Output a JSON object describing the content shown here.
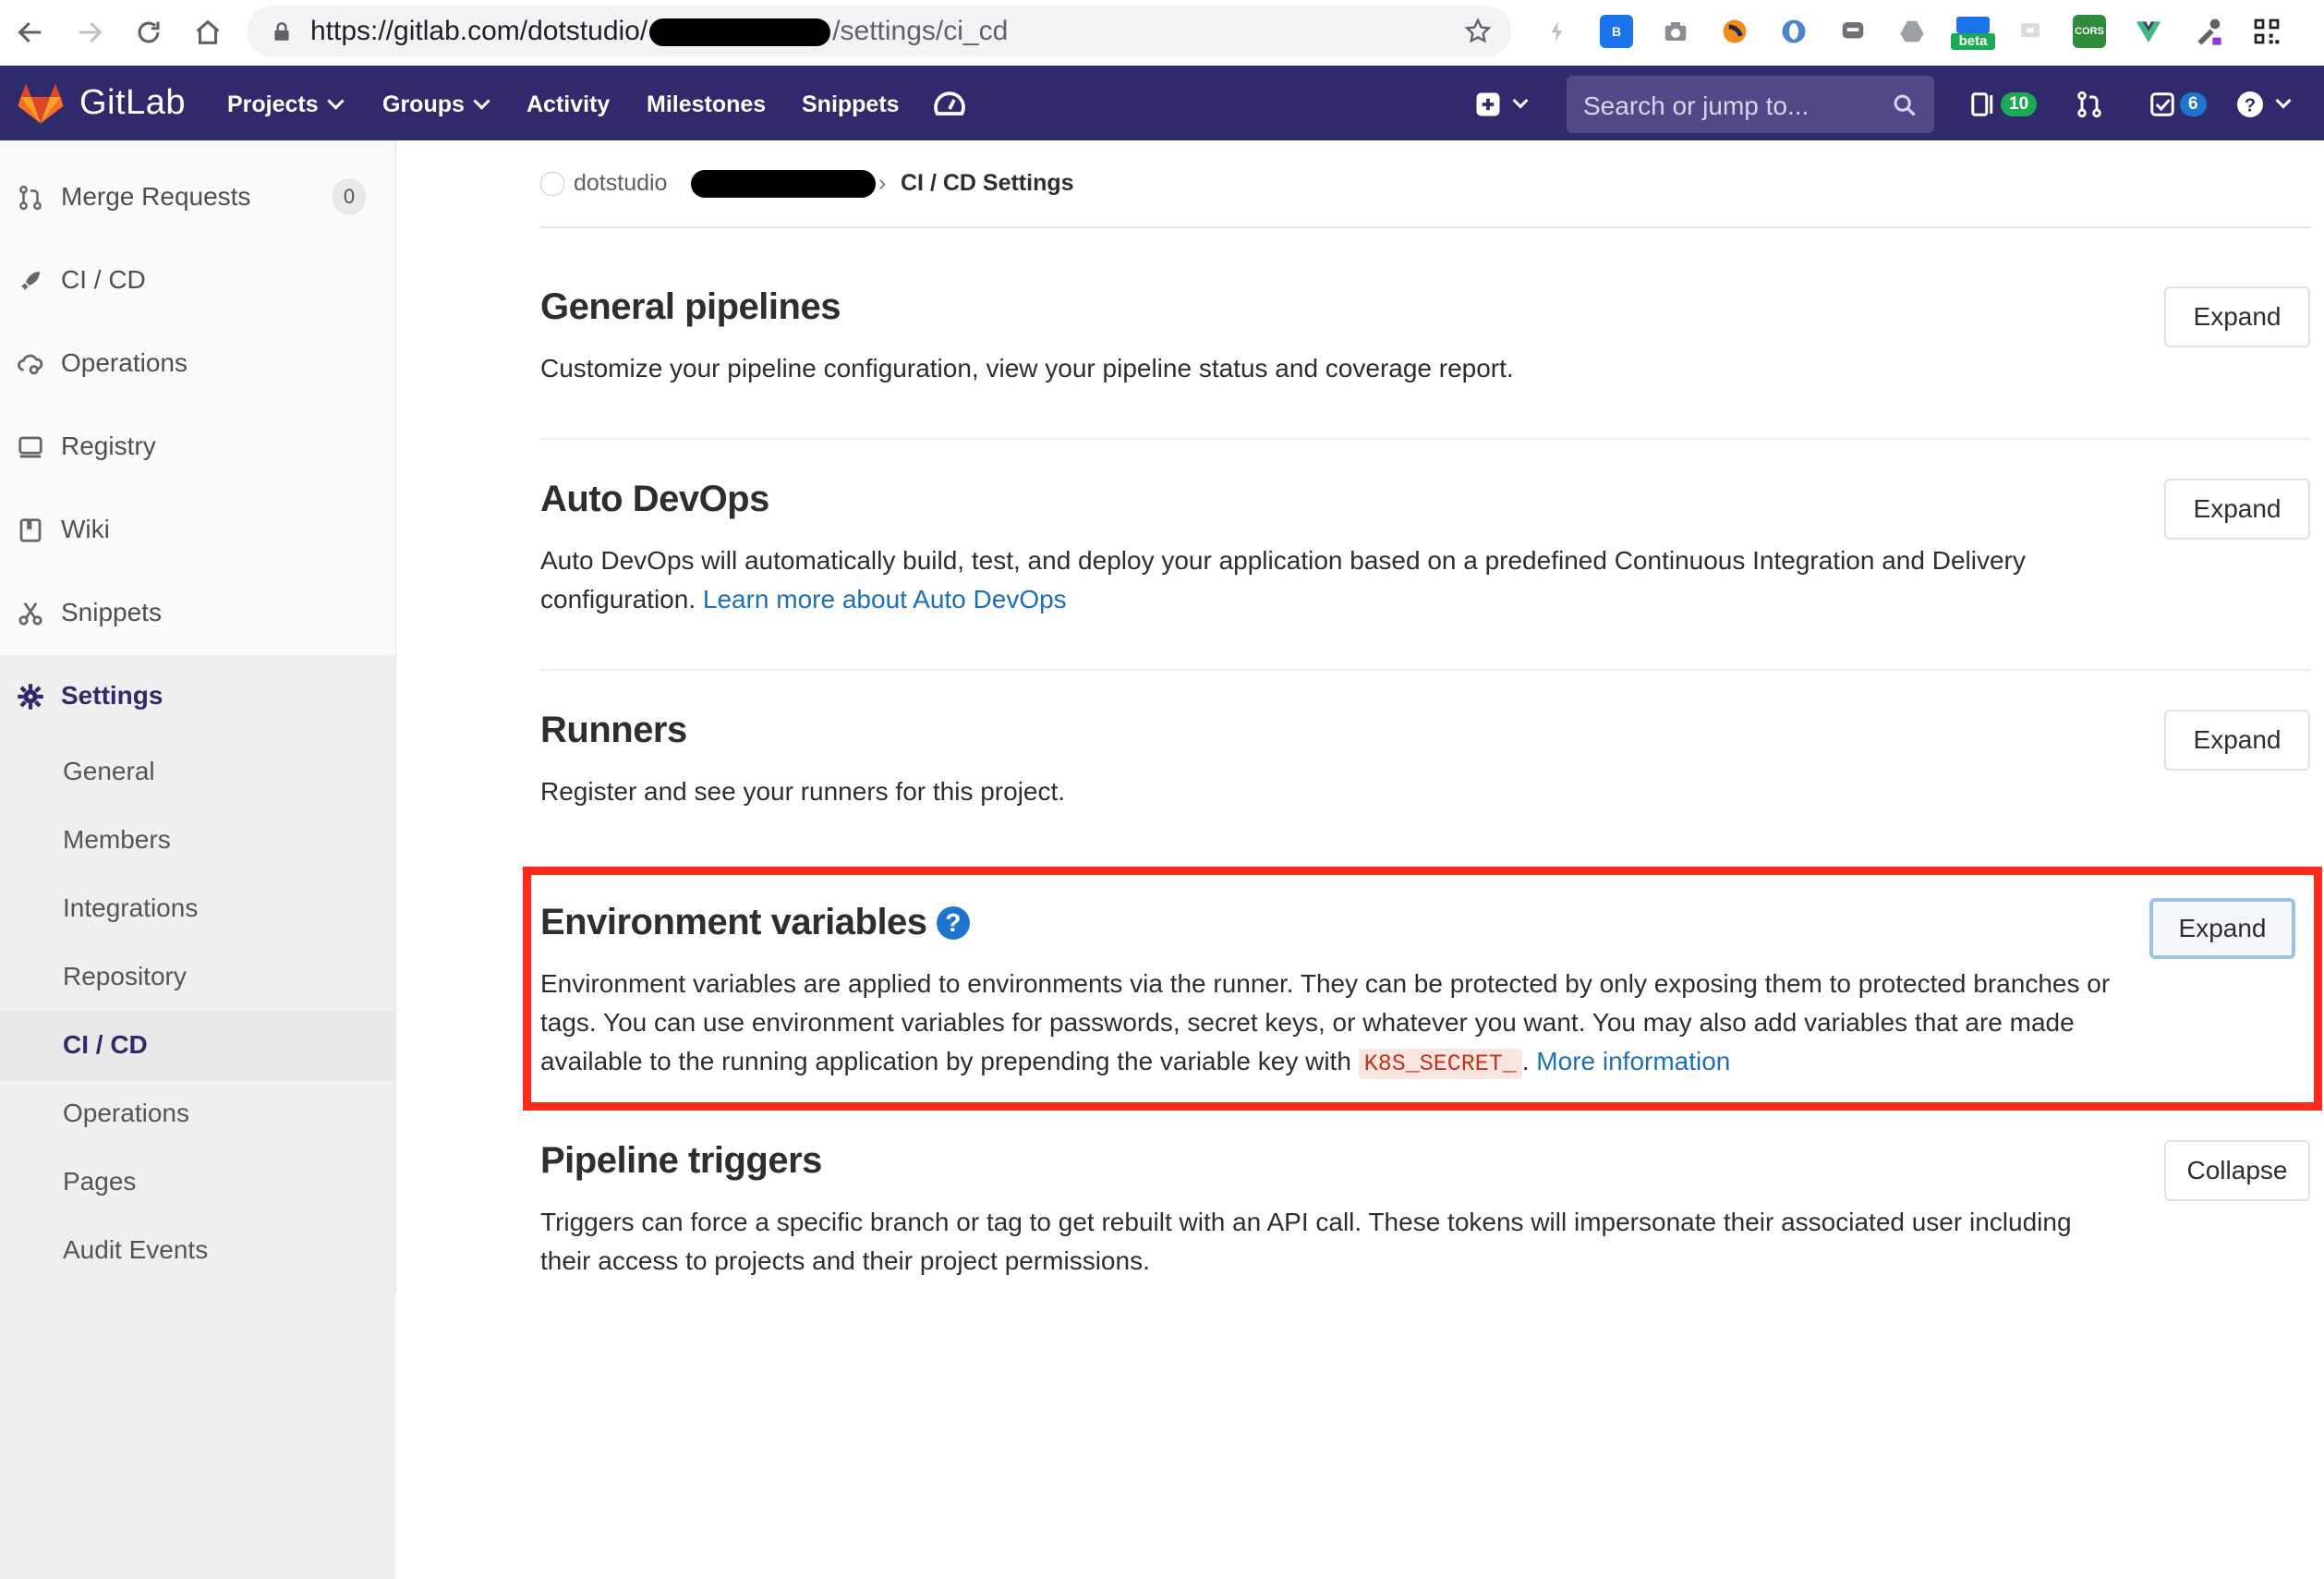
{
  "browser": {
    "url_prefix": "https://gitlab.com/dotstudio/",
    "url_suffix": "/settings/ci_cd",
    "extensions": [
      "bolt-icon",
      "bitly-icon",
      "camera-icon",
      "circle-swirl-icon",
      "opera-icon",
      "chat-icon",
      "drive-icon",
      "beta-ext-icon",
      "ghost-ext-icon",
      "cors-ext-icon",
      "vue-icon",
      "eyedropper-icon",
      "qr-code-icon"
    ],
    "beta_label": "beta",
    "cors_label": "CORS"
  },
  "header": {
    "brand": "GitLab",
    "nav": [
      "Projects",
      "Groups",
      "Activity",
      "Milestones",
      "Snippets"
    ],
    "search_placeholder": "Search or jump to...",
    "issues_count": "10",
    "todos_count": "6",
    "colors": {
      "bg": "#2f2a6b",
      "issues_badge": "#1aaa55",
      "todos_badge": "#1f75cb"
    }
  },
  "sidebar": {
    "items": [
      {
        "label": "Merge Requests",
        "count": "0",
        "icon": "merge-request-icon"
      },
      {
        "label": "CI / CD",
        "icon": "rocket-icon"
      },
      {
        "label": "Operations",
        "icon": "cloud-gear-icon"
      },
      {
        "label": "Registry",
        "icon": "monitor-icon"
      },
      {
        "label": "Wiki",
        "icon": "book-icon"
      },
      {
        "label": "Snippets",
        "icon": "scissors-icon"
      },
      {
        "label": "Settings",
        "icon": "gear-icon"
      }
    ],
    "settings_sub": [
      "General",
      "Members",
      "Integrations",
      "Repository",
      "CI / CD",
      "Operations",
      "Pages",
      "Audit Events"
    ]
  },
  "breadcrumb": {
    "group": "dotstudio",
    "separator": "›",
    "current": "CI / CD Settings"
  },
  "sections": {
    "general": {
      "title": "General pipelines",
      "desc": "Customize your pipeline configuration, view your pipeline status and coverage report.",
      "button": "Expand"
    },
    "autodevops": {
      "title": "Auto DevOps",
      "desc": "Auto DevOps will automatically build, test, and deploy your application based on a predefined Continuous Integration and Delivery configuration.",
      "link": "Learn more about Auto DevOps",
      "button": "Expand"
    },
    "runners": {
      "title": "Runners",
      "desc": "Register and see your runners for this project.",
      "button": "Expand"
    },
    "envvars": {
      "title": "Environment variables",
      "help": "?",
      "desc": "Environment variables are applied to environments via the runner. They can be protected by only exposing them to protected branches or tags. You can use environment variables for passwords, secret keys, or whatever you want. You may also add variables that are made available to the running application by prepending the variable key with",
      "code": "K8S_SECRET_",
      "after_code": ".",
      "link": "More information",
      "button": "Expand"
    },
    "triggers": {
      "title": "Pipeline triggers",
      "desc": "Triggers can force a specific branch or tag to get rebuilt with an API call. These tokens will impersonate their associated user including their access to projects and their project permissions.",
      "button": "Collapse"
    }
  },
  "annotation": {
    "highlight_color": "#ff2a1a"
  }
}
